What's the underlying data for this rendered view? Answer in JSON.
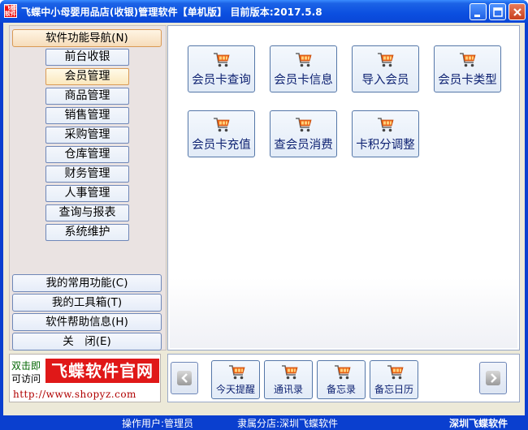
{
  "window": {
    "app_icon_text": "飞蝶软件",
    "title": "飞蝶中小母婴用品店(收银)管理软件【单机版】 目前版本:2017.5.8",
    "controls": [
      "minimize-icon",
      "maximize-icon",
      "close-icon"
    ]
  },
  "nav": {
    "header": "软件功能导航(N)",
    "items": [
      {
        "label": "前台收银",
        "active": false
      },
      {
        "label": "会员管理",
        "active": true
      },
      {
        "label": "商品管理",
        "active": false
      },
      {
        "label": "销售管理",
        "active": false
      },
      {
        "label": "采购管理",
        "active": false
      },
      {
        "label": "仓库管理",
        "active": false
      },
      {
        "label": "财务管理",
        "active": false
      },
      {
        "label": "人事管理",
        "active": false
      },
      {
        "label": "查询与报表",
        "active": false
      },
      {
        "label": "系统维护",
        "active": false
      }
    ],
    "bottom": [
      {
        "label": "我的常用功能(C)"
      },
      {
        "label": "我的工具箱(T)"
      },
      {
        "label": "软件帮助信息(H)"
      },
      {
        "label": "关　闭(E)"
      }
    ]
  },
  "functions": [
    {
      "label": "会员卡查询",
      "icon": "shopping-cart-icon"
    },
    {
      "label": "会员卡信息",
      "icon": "shopping-cart-icon"
    },
    {
      "label": "导入会员",
      "icon": "shopping-cart-icon"
    },
    {
      "label": "会员卡类型",
      "icon": "shopping-cart-icon"
    },
    {
      "label": "会员卡充值",
      "icon": "shopping-cart-icon"
    },
    {
      "label": "查会员消费",
      "icon": "shopping-cart-icon"
    },
    {
      "label": "卡积分调整",
      "icon": "shopping-cart-icon"
    }
  ],
  "ad": {
    "hint_line1": "双击即",
    "hint_line2": "可访问",
    "logo_text": "飞蝶软件官网",
    "url": "http://www.shopyz.com"
  },
  "quickbar": {
    "items": [
      {
        "label": "今天提醒"
      },
      {
        "label": "通讯录"
      },
      {
        "label": "备忘录"
      },
      {
        "label": "备忘日历"
      }
    ],
    "left_arrow": "arrow-left-icon",
    "right_arrow": "arrow-right-icon"
  },
  "status": {
    "operator": "操作用户:管理员",
    "branch": "隶属分店:深圳飞蝶软件",
    "company": "深圳飞蝶软件"
  },
  "colors": {
    "titlebar": "#0b4fe0",
    "button_border": "#5577a8",
    "cart_orange": "#f06a1c",
    "active_nav": "#fbe8bd",
    "ad_red": "#e01818"
  }
}
